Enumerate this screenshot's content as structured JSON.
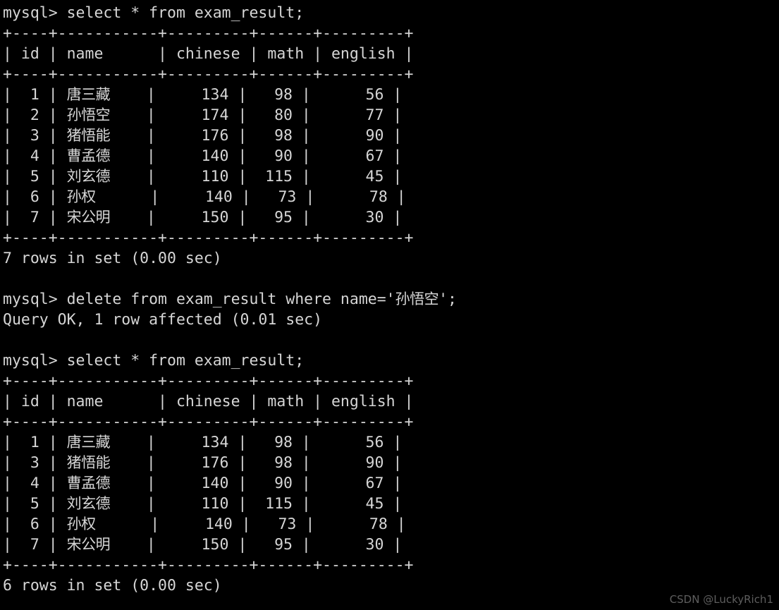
{
  "terminal": {
    "background_color": "#000000",
    "foreground_color": "#d6d6d6",
    "prompt": "mysql>",
    "lines": [
      {
        "id": "cmd-1",
        "text": "mysql> select * from exam_result;"
      },
      {
        "id": "t1-rule-top",
        "text": "+----+-----------+---------+------+---------+"
      },
      {
        "id": "t1-header",
        "text": "| id | name      | chinese | math | english |"
      },
      {
        "id": "t1-rule-mid",
        "text": "+----+-----------+---------+------+---------+"
      },
      {
        "id": "t1-row-1",
        "text": "|  1 | 唐三藏    |     134 |   98 |      56 |"
      },
      {
        "id": "t1-row-2",
        "text": "|  2 | 孙悟空    |     174 |   80 |      77 |"
      },
      {
        "id": "t1-row-3",
        "text": "|  3 | 猪悟能    |     176 |   98 |      90 |"
      },
      {
        "id": "t1-row-4",
        "text": "|  4 | 曹孟德    |     140 |   90 |      67 |"
      },
      {
        "id": "t1-row-5",
        "text": "|  5 | 刘玄德    |     110 |  115 |      45 |"
      },
      {
        "id": "t1-row-6",
        "text": "|  6 | 孙权      |     140 |   73 |      78 |"
      },
      {
        "id": "t1-row-7",
        "text": "|  7 | 宋公明    |     150 |   95 |      30 |"
      },
      {
        "id": "t1-rule-bot",
        "text": "+----+-----------+---------+------+---------+"
      },
      {
        "id": "t1-status",
        "text": "7 rows in set (0.00 sec)"
      },
      {
        "id": "blank-1",
        "text": ""
      },
      {
        "id": "cmd-2",
        "text": "mysql> delete from exam_result where name='孙悟空';"
      },
      {
        "id": "cmd-2-result",
        "text": "Query OK, 1 row affected (0.01 sec)"
      },
      {
        "id": "blank-2",
        "text": ""
      },
      {
        "id": "cmd-3",
        "text": "mysql> select * from exam_result;"
      },
      {
        "id": "t2-rule-top",
        "text": "+----+-----------+---------+------+---------+"
      },
      {
        "id": "t2-header",
        "text": "| id | name      | chinese | math | english |"
      },
      {
        "id": "t2-rule-mid",
        "text": "+----+-----------+---------+------+---------+"
      },
      {
        "id": "t2-row-1",
        "text": "|  1 | 唐三藏    |     134 |   98 |      56 |"
      },
      {
        "id": "t2-row-3",
        "text": "|  3 | 猪悟能    |     176 |   98 |      90 |"
      },
      {
        "id": "t2-row-4",
        "text": "|  4 | 曹孟德    |     140 |   90 |      67 |"
      },
      {
        "id": "t2-row-5",
        "text": "|  5 | 刘玄德    |     110 |  115 |      45 |"
      },
      {
        "id": "t2-row-6",
        "text": "|  6 | 孙权      |     140 |   73 |      78 |"
      },
      {
        "id": "t2-row-7",
        "text": "|  7 | 宋公明    |     150 |   95 |      30 |"
      },
      {
        "id": "t2-rule-bot",
        "text": "+----+-----------+---------+------+---------+"
      },
      {
        "id": "t2-status",
        "text": "6 rows in set (0.00 sec)"
      }
    ]
  },
  "queries": [
    {
      "sql": "select * from exam_result;",
      "status": "7 rows in set (0.00 sec)"
    },
    {
      "sql": "delete from exam_result where name='孙悟空';",
      "status": "Query OK, 1 row affected (0.01 sec)"
    },
    {
      "sql": "select * from exam_result;",
      "status": "6 rows in set (0.00 sec)"
    }
  ],
  "result_tables": [
    {
      "name": "exam_result-before-delete",
      "columns": [
        "id",
        "name",
        "chinese",
        "math",
        "english"
      ],
      "rows": [
        [
          "1",
          "唐三藏",
          "134",
          "98",
          "56"
        ],
        [
          "2",
          "孙悟空",
          "174",
          "80",
          "77"
        ],
        [
          "3",
          "猪悟能",
          "176",
          "98",
          "90"
        ],
        [
          "4",
          "曹孟德",
          "140",
          "90",
          "67"
        ],
        [
          "5",
          "刘玄德",
          "110",
          "115",
          "45"
        ],
        [
          "6",
          "孙权",
          "140",
          "73",
          "78"
        ],
        [
          "7",
          "宋公明",
          "150",
          "95",
          "30"
        ]
      ],
      "row_count_text": "7 rows in set (0.00 sec)"
    },
    {
      "name": "exam_result-after-delete",
      "columns": [
        "id",
        "name",
        "chinese",
        "math",
        "english"
      ],
      "rows": [
        [
          "1",
          "唐三藏",
          "134",
          "98",
          "56"
        ],
        [
          "3",
          "猪悟能",
          "176",
          "98",
          "90"
        ],
        [
          "4",
          "曹孟德",
          "140",
          "90",
          "67"
        ],
        [
          "5",
          "刘玄德",
          "110",
          "115",
          "45"
        ],
        [
          "6",
          "孙权",
          "140",
          "73",
          "78"
        ],
        [
          "7",
          "宋公明",
          "150",
          "95",
          "30"
        ]
      ],
      "row_count_text": "6 rows in set (0.00 sec)"
    }
  ],
  "watermark": {
    "text": "CSDN @LuckyRich1",
    "color": "#5e5e5e"
  }
}
